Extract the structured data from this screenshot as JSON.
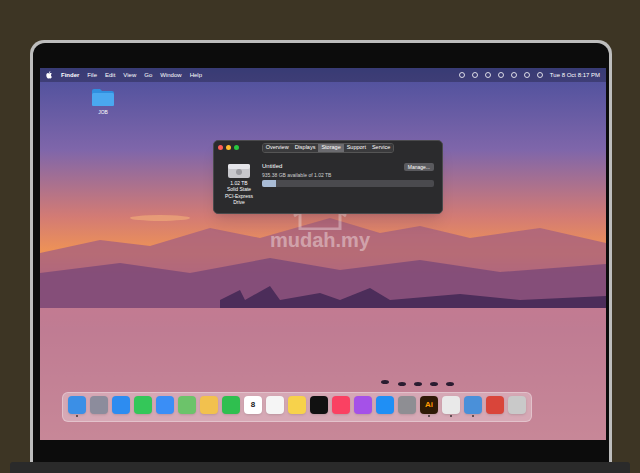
{
  "menu_bar": {
    "app": "Finder",
    "items": [
      "File",
      "Edit",
      "View",
      "Go",
      "Window",
      "Help"
    ],
    "clock": "Tue 8 Oct 8:17 PM"
  },
  "desktop": {
    "icons": [
      {
        "label": "JOB"
      }
    ]
  },
  "window": {
    "tabs": [
      {
        "label": "Overview",
        "selected": false
      },
      {
        "label": "Displays",
        "selected": false
      },
      {
        "label": "Storage",
        "selected": true
      },
      {
        "label": "Support",
        "selected": false
      },
      {
        "label": "Service",
        "selected": false
      }
    ],
    "disk": {
      "capacity": "1.02 TB",
      "type": "Solid State PCI-Express Drive",
      "name": "Untitled",
      "available": "935.38 GB available of 1.02 TB",
      "level": 0.08
    },
    "buttons": [
      "Manage..."
    ]
  },
  "dock": {
    "items": [
      {
        "color": "#3b8fe6",
        "label": "",
        "running": true
      },
      {
        "color": "#8c8c9c",
        "label": "",
        "running": false
      },
      {
        "color": "#2d8cf0",
        "label": "",
        "running": false
      },
      {
        "color": "#34c759",
        "label": "",
        "running": false
      },
      {
        "color": "#3a8ef6",
        "label": "",
        "running": false
      },
      {
        "color": "#6cc36a",
        "label": "",
        "running": false
      },
      {
        "color": "#f2c14e",
        "label": "",
        "running": false
      },
      {
        "color": "#2fbf4f",
        "label": "",
        "running": false
      },
      {
        "color": "#ffffff",
        "label": "8",
        "running": false
      },
      {
        "color": "#f5f5f5",
        "label": "",
        "running": false
      },
      {
        "color": "#f7d24b",
        "label": "",
        "running": false
      },
      {
        "color": "#111111",
        "label": "",
        "running": false
      },
      {
        "color": "#fa4162",
        "label": "",
        "running": false
      },
      {
        "color": "#a551e8",
        "label": "",
        "running": false
      },
      {
        "color": "#1f8ff5",
        "label": "",
        "running": false
      },
      {
        "color": "#8e8e93",
        "label": "",
        "running": false
      },
      {
        "color": "#2f1a06",
        "label": "Ai",
        "running": true
      },
      {
        "color": "#e9e9e9",
        "label": "",
        "running": true
      },
      {
        "color": "#4a90d9",
        "label": "",
        "running": true
      },
      {
        "color": "#d9453a",
        "label": "",
        "running": false
      },
      {
        "color": "#c9c9c9",
        "label": "",
        "running": false
      }
    ]
  },
  "watermark": "mudah.my"
}
